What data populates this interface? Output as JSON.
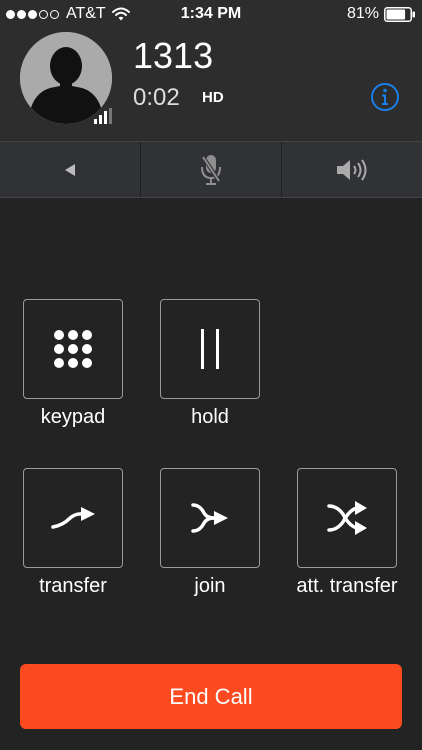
{
  "status_bar": {
    "signal_dots_filled": 3,
    "signal_dots_total": 5,
    "carrier": "AT&T",
    "time": "1:34 PM",
    "battery_percent": "81%",
    "battery_level": 0.81
  },
  "call": {
    "number": "1313",
    "duration": "0:02",
    "quality_badge": "HD"
  },
  "controls": [
    {
      "icon": "back-triangle-icon"
    },
    {
      "icon": "microphone-muted-icon"
    },
    {
      "icon": "speaker-icon"
    }
  ],
  "actions": {
    "keypad": {
      "label": "keypad",
      "icon": "keypad-icon"
    },
    "hold": {
      "label": "hold",
      "icon": "pause-icon"
    },
    "transfer": {
      "label": "transfer",
      "icon": "transfer-arrow-icon"
    },
    "join": {
      "label": "join",
      "icon": "merge-arrow-icon"
    },
    "att_transfer": {
      "label": "att. transfer",
      "icon": "shuffle-arrows-icon"
    }
  },
  "end_call": {
    "label": "End Call"
  },
  "colors": {
    "background": "#232323",
    "header": "#2d2d2d",
    "control_bar": "#303236",
    "end_call": "#fb4a1f",
    "info_accent": "#1a7fe8"
  }
}
